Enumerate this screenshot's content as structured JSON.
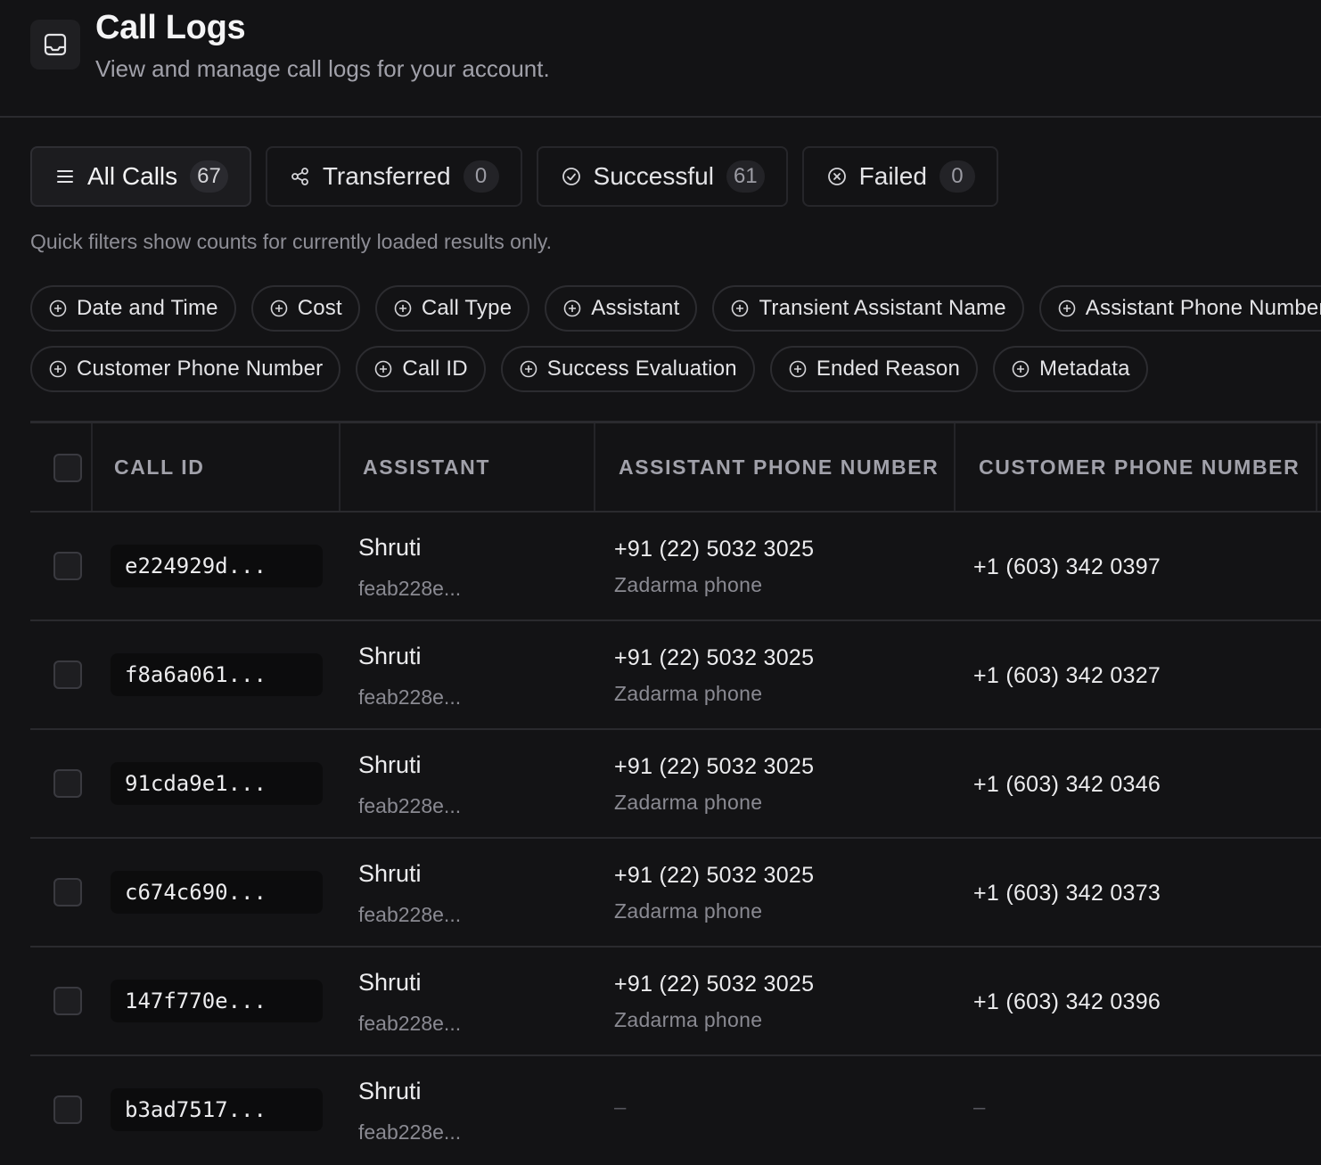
{
  "header": {
    "title": "Call Logs",
    "subtitle": "View and manage call logs for your account.",
    "icon": "inbox-icon"
  },
  "tabs": [
    {
      "label": "All Calls",
      "count": "67",
      "icon": "list-icon",
      "active": true
    },
    {
      "label": "Transferred",
      "count": "0",
      "icon": "share-icon",
      "active": false
    },
    {
      "label": "Successful",
      "count": "61",
      "icon": "check-circle-icon",
      "active": false
    },
    {
      "label": "Failed",
      "count": "0",
      "icon": "x-circle-icon",
      "active": false
    }
  ],
  "filter_note": "Quick filters show counts for currently loaded results only.",
  "filters_row1": [
    "Date and Time",
    "Cost",
    "Call Type",
    "Assistant",
    "Transient Assistant Name",
    "Assistant Phone Number"
  ],
  "filters_row2": [
    "Customer Phone Number",
    "Call ID",
    "Success Evaluation",
    "Ended Reason",
    "Metadata"
  ],
  "columns": {
    "call_id": "CALL ID",
    "assistant": "ASSISTANT",
    "assistant_phone": "ASSISTANT PHONE NUMBER",
    "customer_phone": "CUSTOMER PHONE NUMBER"
  },
  "rows": [
    {
      "call_id": "e224929d...",
      "assistant": "Shruti",
      "assistant_id": "feab228e...",
      "assistant_phone": "+91 (22) 5032 3025",
      "phone_provider": "Zadarma phone",
      "customer_phone": "+1 (603) 342 0397"
    },
    {
      "call_id": "f8a6a061...",
      "assistant": "Shruti",
      "assistant_id": "feab228e...",
      "assistant_phone": "+91 (22) 5032 3025",
      "phone_provider": "Zadarma phone",
      "customer_phone": "+1 (603) 342 0327"
    },
    {
      "call_id": "91cda9e1...",
      "assistant": "Shruti",
      "assistant_id": "feab228e...",
      "assistant_phone": "+91 (22) 5032 3025",
      "phone_provider": "Zadarma phone",
      "customer_phone": "+1 (603) 342 0346"
    },
    {
      "call_id": "c674c690...",
      "assistant": "Shruti",
      "assistant_id": "feab228e...",
      "assistant_phone": "+91 (22) 5032 3025",
      "phone_provider": "Zadarma phone",
      "customer_phone": "+1 (603) 342 0373"
    },
    {
      "call_id": "147f770e...",
      "assistant": "Shruti",
      "assistant_id": "feab228e...",
      "assistant_phone": "+91 (22) 5032 3025",
      "phone_provider": "Zadarma phone",
      "customer_phone": "+1 (603) 342 0396"
    },
    {
      "call_id": "b3ad7517...",
      "assistant": "Shruti",
      "assistant_id": "feab228e...",
      "assistant_phone": "–",
      "phone_provider": "",
      "customer_phone": "–"
    }
  ]
}
